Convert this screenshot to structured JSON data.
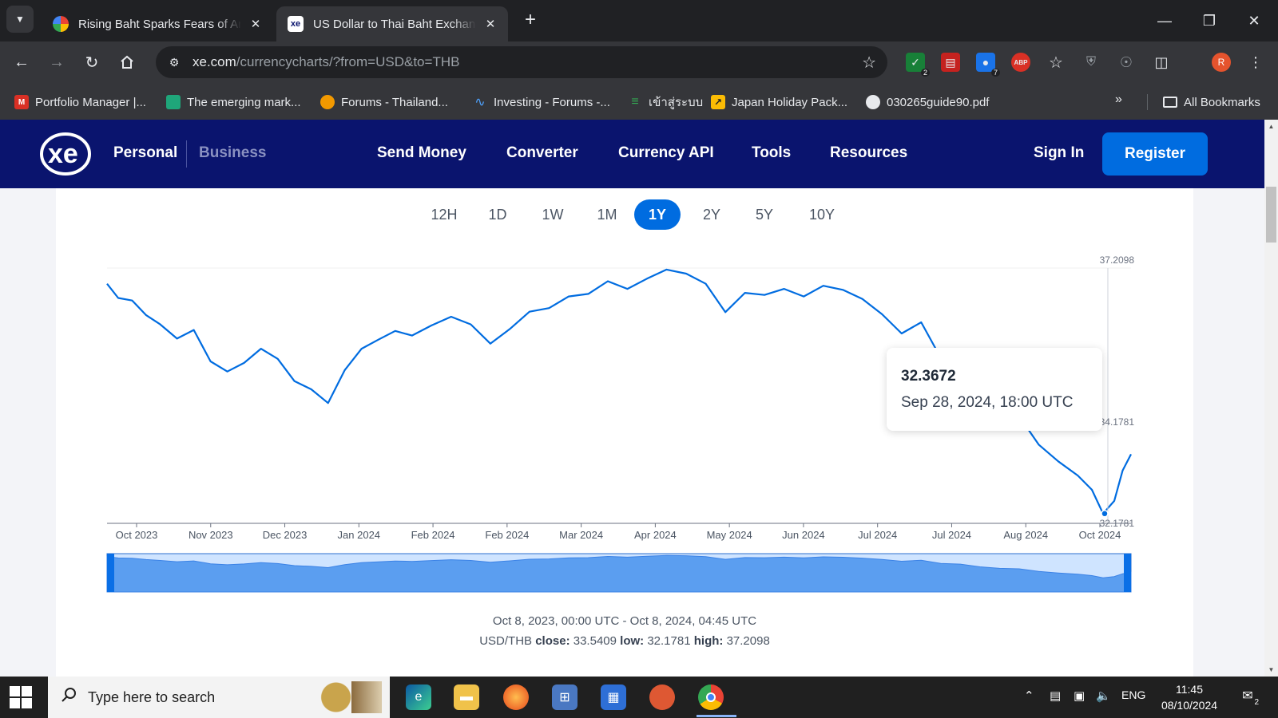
{
  "browser": {
    "tabs": [
      {
        "title": "Rising Baht Sparks Fears of Another"
      },
      {
        "title": "US Dollar to Thai Baht Exchange Rate Chart"
      }
    ],
    "address": {
      "host": "xe.com",
      "path": "/currencycharts/?from=USD&to=THB"
    },
    "extensions": [
      {
        "name": "shield-extension-icon",
        "badge": "2"
      },
      {
        "name": "pdf-extension-icon",
        "badge": ""
      },
      {
        "name": "puzzle-blue-extension-icon",
        "badge": "7"
      },
      {
        "name": "adblock-extension-icon",
        "label": "ABP",
        "badge": ""
      }
    ],
    "avatar_initial": "R",
    "bookmarks": [
      {
        "label": "Portfolio Manager |...",
        "icon_color": "#d93025"
      },
      {
        "label": "The emerging mark...",
        "icon_color": "#1fa67a"
      },
      {
        "label": "Forums - Thailand...",
        "icon_color": "#f29900"
      },
      {
        "label": "Investing - Forums -...",
        "icon_color": "#1a73e8"
      },
      {
        "label": "เข้าสู่ระบบ",
        "icon_color": "#34a853"
      },
      {
        "label": "Japan Holiday Pack...",
        "icon_color": "#fbbc04"
      },
      {
        "label": "030265guide90.pdf",
        "icon_color": "#e8eaed"
      }
    ],
    "all_bookmarks": "All Bookmarks"
  },
  "site": {
    "logo": "xe",
    "segments": [
      "Personal",
      "Business"
    ],
    "nav": [
      "Send Money",
      "Converter",
      "Currency API",
      "Tools",
      "Resources"
    ],
    "sign_in": "Sign In",
    "register": "Register",
    "brand_color": "#0a146e",
    "accent_color": "#006ce0"
  },
  "ranges": {
    "options": [
      "12H",
      "1D",
      "1W",
      "1M",
      "1Y",
      "2Y",
      "5Y",
      "10Y"
    ],
    "selected": "1Y"
  },
  "chart_data": {
    "type": "line",
    "series": [
      {
        "name": "USD/THB",
        "color": "#006ce0"
      }
    ],
    "x": [
      "2023-10-08",
      "2023-10-12",
      "2023-10-17",
      "2023-10-22",
      "2023-10-27",
      "2023-11-02",
      "2023-11-08",
      "2023-11-14",
      "2023-11-20",
      "2023-11-26",
      "2023-12-02",
      "2023-12-08",
      "2023-12-14",
      "2023-12-20",
      "2023-12-26",
      "2024-01-01",
      "2024-01-07",
      "2024-01-13",
      "2024-01-19",
      "2024-01-25",
      "2024-02-01",
      "2024-02-08",
      "2024-02-15",
      "2024-02-22",
      "2024-02-29",
      "2024-03-07",
      "2024-03-14",
      "2024-03-21",
      "2024-03-28",
      "2024-04-04",
      "2024-04-11",
      "2024-04-18",
      "2024-04-25",
      "2024-05-02",
      "2024-05-09",
      "2024-05-16",
      "2024-05-23",
      "2024-05-30",
      "2024-06-06",
      "2024-06-13",
      "2024-06-20",
      "2024-06-27",
      "2024-07-04",
      "2024-07-11",
      "2024-07-18",
      "2024-07-25",
      "2024-08-01",
      "2024-08-08",
      "2024-08-15",
      "2024-08-22",
      "2024-08-29",
      "2024-09-05",
      "2024-09-12",
      "2024-09-19",
      "2024-09-24",
      "2024-09-28",
      "2024-10-02",
      "2024-10-05",
      "2024-10-08"
    ],
    "values": [
      36.9,
      36.62,
      36.57,
      36.28,
      36.1,
      35.82,
      35.99,
      35.37,
      35.17,
      35.34,
      35.62,
      35.42,
      34.98,
      34.82,
      34.55,
      35.2,
      35.62,
      35.8,
      35.97,
      35.88,
      36.08,
      36.25,
      36.1,
      35.72,
      36.01,
      36.35,
      36.42,
      36.65,
      36.7,
      36.95,
      36.8,
      37.0,
      37.18,
      37.1,
      36.9,
      36.34,
      36.72,
      36.68,
      36.8,
      36.65,
      36.86,
      36.78,
      36.6,
      36.3,
      35.92,
      36.14,
      35.44,
      35.3,
      34.72,
      34.4,
      34.29,
      33.73,
      33.4,
      33.12,
      32.84,
      32.37,
      32.62,
      33.22,
      33.54
    ],
    "x_tick_labels": [
      "Oct 2023",
      "Nov 2023",
      "Dec 2023",
      "Jan 2024",
      "Feb 2024",
      "Feb 2024",
      "Mar 2024",
      "Apr 2024",
      "May 2024",
      "Jun 2024",
      "Jul 2024",
      "Jul 2024",
      "Aug 2024",
      "Oct 2024"
    ],
    "y_tick_labels": [
      "37.2098",
      "34.1781",
      "32.1781"
    ],
    "ylim": [
      32.1781,
      37.2098
    ],
    "xlim": [
      "2023-10-08",
      "2024-10-08"
    ],
    "grid": false,
    "tooltip": {
      "value": "32.3672",
      "date": "Sep 28, 2024, 18:00 UTC"
    }
  },
  "summary": {
    "period": "Oct 8, 2023, 00:00 UTC - Oct 8, 2024, 04:45 UTC",
    "pair": "USD/THB",
    "close_label": "close:",
    "close": "33.5409",
    "low_label": "low:",
    "low": "32.1781",
    "high_label": "high:",
    "high": "37.2098"
  },
  "taskbar": {
    "search_placeholder": "Type here to search",
    "apps": [
      "edge-icon",
      "file-explorer-icon",
      "firefox-icon",
      "calculator-icon",
      "calendar-icon",
      "duckduckgo-icon",
      "chrome-icon"
    ],
    "language": "ENG",
    "time": "11:45",
    "date": "08/10/2024",
    "notifications": "2"
  }
}
